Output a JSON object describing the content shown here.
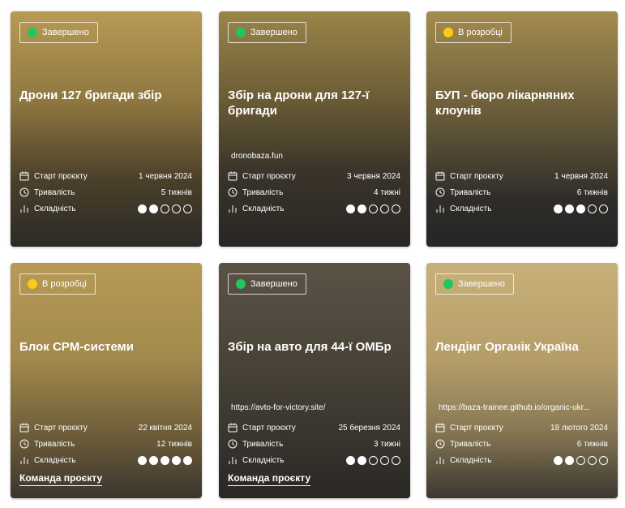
{
  "cards": [
    {
      "status": "Завершено",
      "status_color": "#22c55e",
      "title": "Дрони 127 бригади збір",
      "link": "",
      "start_label": "Старт проєкту",
      "start": "1 червня 2024",
      "duration_label": "Тривалість",
      "duration": "5 тижнів",
      "difficulty_label": "Складність",
      "difficulty": 2,
      "team": ""
    },
    {
      "status": "Завершено",
      "status_color": "#22c55e",
      "title": "Збір на дрони для 127-ї бригади",
      "link": "dronobaza.fun",
      "start_label": "Старт проєкту",
      "start": "3 червня 2024",
      "duration_label": "Тривалість",
      "duration": "4 тижні",
      "difficulty_label": "Складність",
      "difficulty": 2,
      "team": ""
    },
    {
      "status": "В розробці",
      "status_color": "#facc15",
      "title": "БУП - бюро лікарняних клоунів",
      "link": "",
      "start_label": "Старт проєкту",
      "start": "1 червня 2024",
      "duration_label": "Тривалість",
      "duration": "6 тижнів",
      "difficulty_label": "Складність",
      "difficulty": 3,
      "team": ""
    },
    {
      "status": "В розробці",
      "status_color": "#facc15",
      "title": "Блок CPM-системи",
      "link": "",
      "start_label": "Старт проєкту",
      "start": "22 квітня 2024",
      "duration_label": "Тривалість",
      "duration": "12 тижнів",
      "difficulty_label": "Складність",
      "difficulty": 5,
      "team": "Команда проєкту"
    },
    {
      "status": "Завершено",
      "status_color": "#22c55e",
      "title": "Збір на авто для 44-ї ОМБр",
      "link": "https://avto-for-victory.site/",
      "start_label": "Старт проєкту",
      "start": "25 березня 2024",
      "duration_label": "Тривалість",
      "duration": "3 тижні",
      "difficulty_label": "Складність",
      "difficulty": 2,
      "team": "Команда проєкту"
    },
    {
      "status": "Завершено",
      "status_color": "#22c55e",
      "title": "Лендінг Органік Україна",
      "link": "https://baza-trainee.github.io/organic-ukr...",
      "start_label": "Старт проєкту",
      "start": "18 лютого 2024",
      "duration_label": "Тривалість",
      "duration": "6 тижнів",
      "difficulty_label": "Складність",
      "difficulty": 2,
      "team": ""
    }
  ],
  "difficulty_max": 5
}
